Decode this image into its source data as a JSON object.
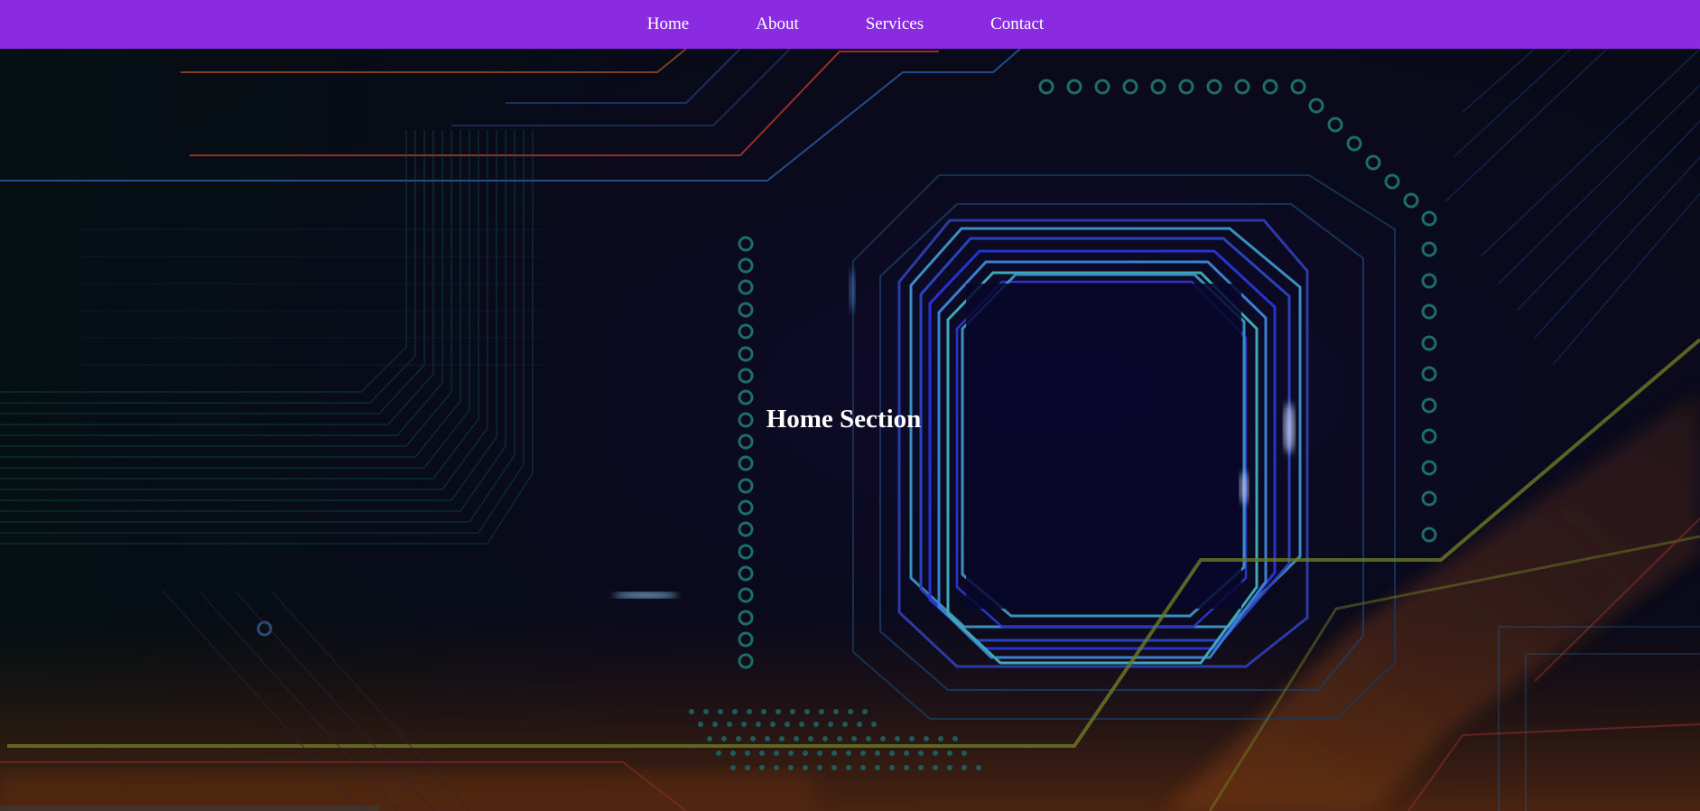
{
  "nav": {
    "items": [
      {
        "label": "Home"
      },
      {
        "label": "About"
      },
      {
        "label": "Services"
      },
      {
        "label": "Contact"
      }
    ]
  },
  "hero": {
    "title": "Home Section",
    "background": "circuit-board-image"
  },
  "colors": {
    "nav_background": "#8a2be2",
    "nav_text": "#ffffff",
    "hero_background": "#0b0a16"
  }
}
